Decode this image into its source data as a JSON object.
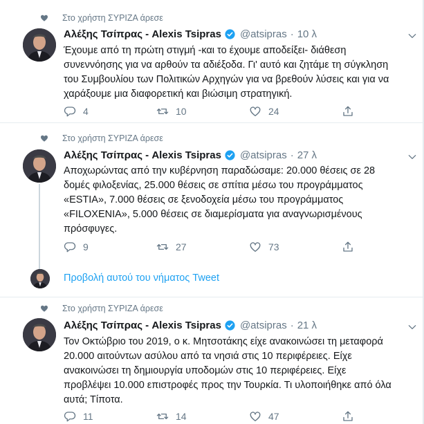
{
  "colors": {
    "accent": "#1da1f2",
    "secondary_text": "#657786",
    "primary_text": "#14171a",
    "divider": "#e6ecf0"
  },
  "tweets": [
    {
      "social_context": "Στο χρήστη ΣΥΡΙΖΑ άρεσε",
      "name": "Αλέξης Τσίπρας - Alexis Tsipras",
      "handle": "@atsipras",
      "separator": "·",
      "time": "10 λ",
      "text_lines": [
        "Έχουμε από τη πρώτη στιγμή -και το έχουμε αποδείξει- διάθεση",
        "συνεννόησης για να αρθούν τα αδιέξοδα. Γι' αυτό και ζητάμε τη σύγκληση",
        "του Συμβουλίου των Πολιτικών Αρχηγών για να βρεθούν λύσεις και για να",
        "χαράξουμε μια διαφορετική και βιώσιμη στρατηγική."
      ],
      "replies": "4",
      "retweets": "10",
      "likes": "24"
    },
    {
      "social_context": "Στο χρήστη ΣΥΡΙΖΑ άρεσε",
      "name": "Αλέξης Τσίπρας - Alexis Tsipras",
      "handle": "@atsipras",
      "separator": "·",
      "time": "27 λ",
      "text_lines": [
        "Αποχωρώντας από την κυβέρνηση παραδώσαμε: 20.000 θέσεις σε 28",
        "δομές φιλοξενίας, 25.000 θέσεις σε σπίτια μέσω του προγράμματος",
        "«ESTIA», 7.000 θέσεις σε ξενοδοχεία μέσω του προγράμματος",
        "«FILOXENIA», 5.000 θέσεις σε διαμερίσματα για αναγνωρισμένους",
        "πρόσφυγες."
      ],
      "replies": "9",
      "retweets": "27",
      "likes": "73"
    },
    {
      "social_context": "Στο χρήστη ΣΥΡΙΖΑ άρεσε",
      "name": "Αλέξης Τσίπρας - Alexis Tsipras",
      "handle": "@atsipras",
      "separator": "·",
      "time": "21 λ",
      "text_lines": [
        "Τον Οκτώβριο του 2019, ο κ. Μητσοτάκης είχε ανακοινώσει τη μεταφορά",
        "20.000 αιτούντων ασύλου από τα νησιά στις 10 περιφέρειες. Είχε",
        "ανακοινώσει τη δημιουργία υποδομών στις 10 περιφέρειες. Είχε",
        "προβλέψει 10.000 επιστροφές προς την Τουρκία. Τι υλοποιήθηκε από όλα",
        "αυτά; Τίποτα."
      ],
      "replies": "11",
      "retweets": "14",
      "likes": "47"
    }
  ],
  "thread": {
    "link_text": "Προβολή αυτού του νήματος Tweet"
  },
  "icons": {
    "social_context": "heart-icon",
    "verified": "verified-badge-icon",
    "menu": "chevron-down-icon",
    "reply": "reply-icon",
    "retweet": "retweet-icon",
    "like": "like-icon",
    "share": "share-icon"
  }
}
